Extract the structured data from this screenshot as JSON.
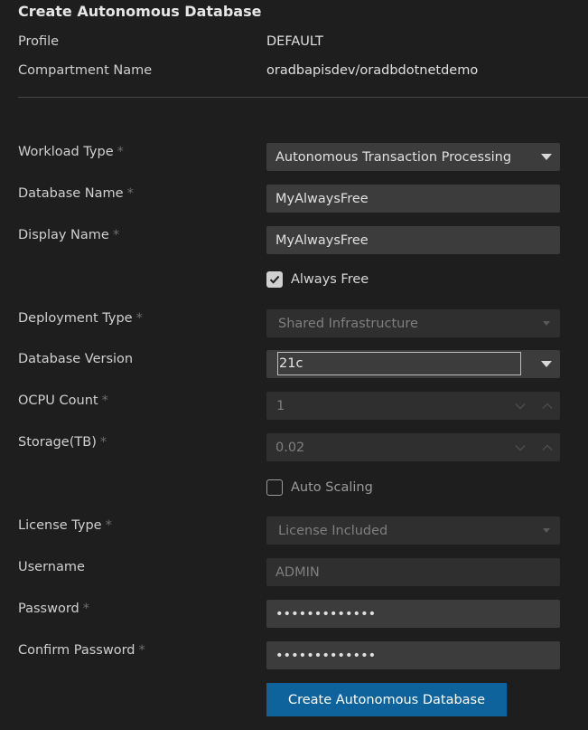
{
  "form": {
    "title": "Create Autonomous Database",
    "profile": {
      "label": "Profile",
      "value": "DEFAULT"
    },
    "compartment": {
      "label": "Compartment Name",
      "value": "oradbapisdev/oradbdotnetdemo"
    },
    "required_marker": "*",
    "workload_type": {
      "label": "Workload Type",
      "value": "Autonomous Transaction Processing"
    },
    "database_name": {
      "label": "Database Name",
      "value": "MyAlwaysFree"
    },
    "display_name": {
      "label": "Display Name",
      "value": "MyAlwaysFree"
    },
    "always_free": {
      "label": "Always Free",
      "checked": true
    },
    "deployment_type": {
      "label": "Deployment Type",
      "value": "Shared Infrastructure"
    },
    "database_version": {
      "label": "Database Version",
      "value": "21c"
    },
    "ocpu_count": {
      "label": "OCPU Count",
      "value": "1"
    },
    "storage": {
      "label": "Storage(TB)",
      "value": "0.02"
    },
    "auto_scaling": {
      "label": "Auto Scaling",
      "checked": false
    },
    "license_type": {
      "label": "License Type",
      "value": "License Included"
    },
    "username": {
      "label": "Username",
      "placeholder": "ADMIN"
    },
    "password": {
      "label": "Password",
      "value": "•••••••••••••"
    },
    "confirm_password": {
      "label": "Confirm Password",
      "value": "•••••••••••••"
    },
    "submit_label": "Create Autonomous Database"
  },
  "icons": {
    "dropdown": "chevron-down-icon",
    "spin_down": "chevron-down-icon",
    "spin_up": "chevron-up-icon",
    "check": "check-icon"
  },
  "colors": {
    "background": "#1e1e1e",
    "input": "#3c3c3c",
    "input_disabled": "#2f2f2f",
    "primary_button": "#0e639c"
  }
}
